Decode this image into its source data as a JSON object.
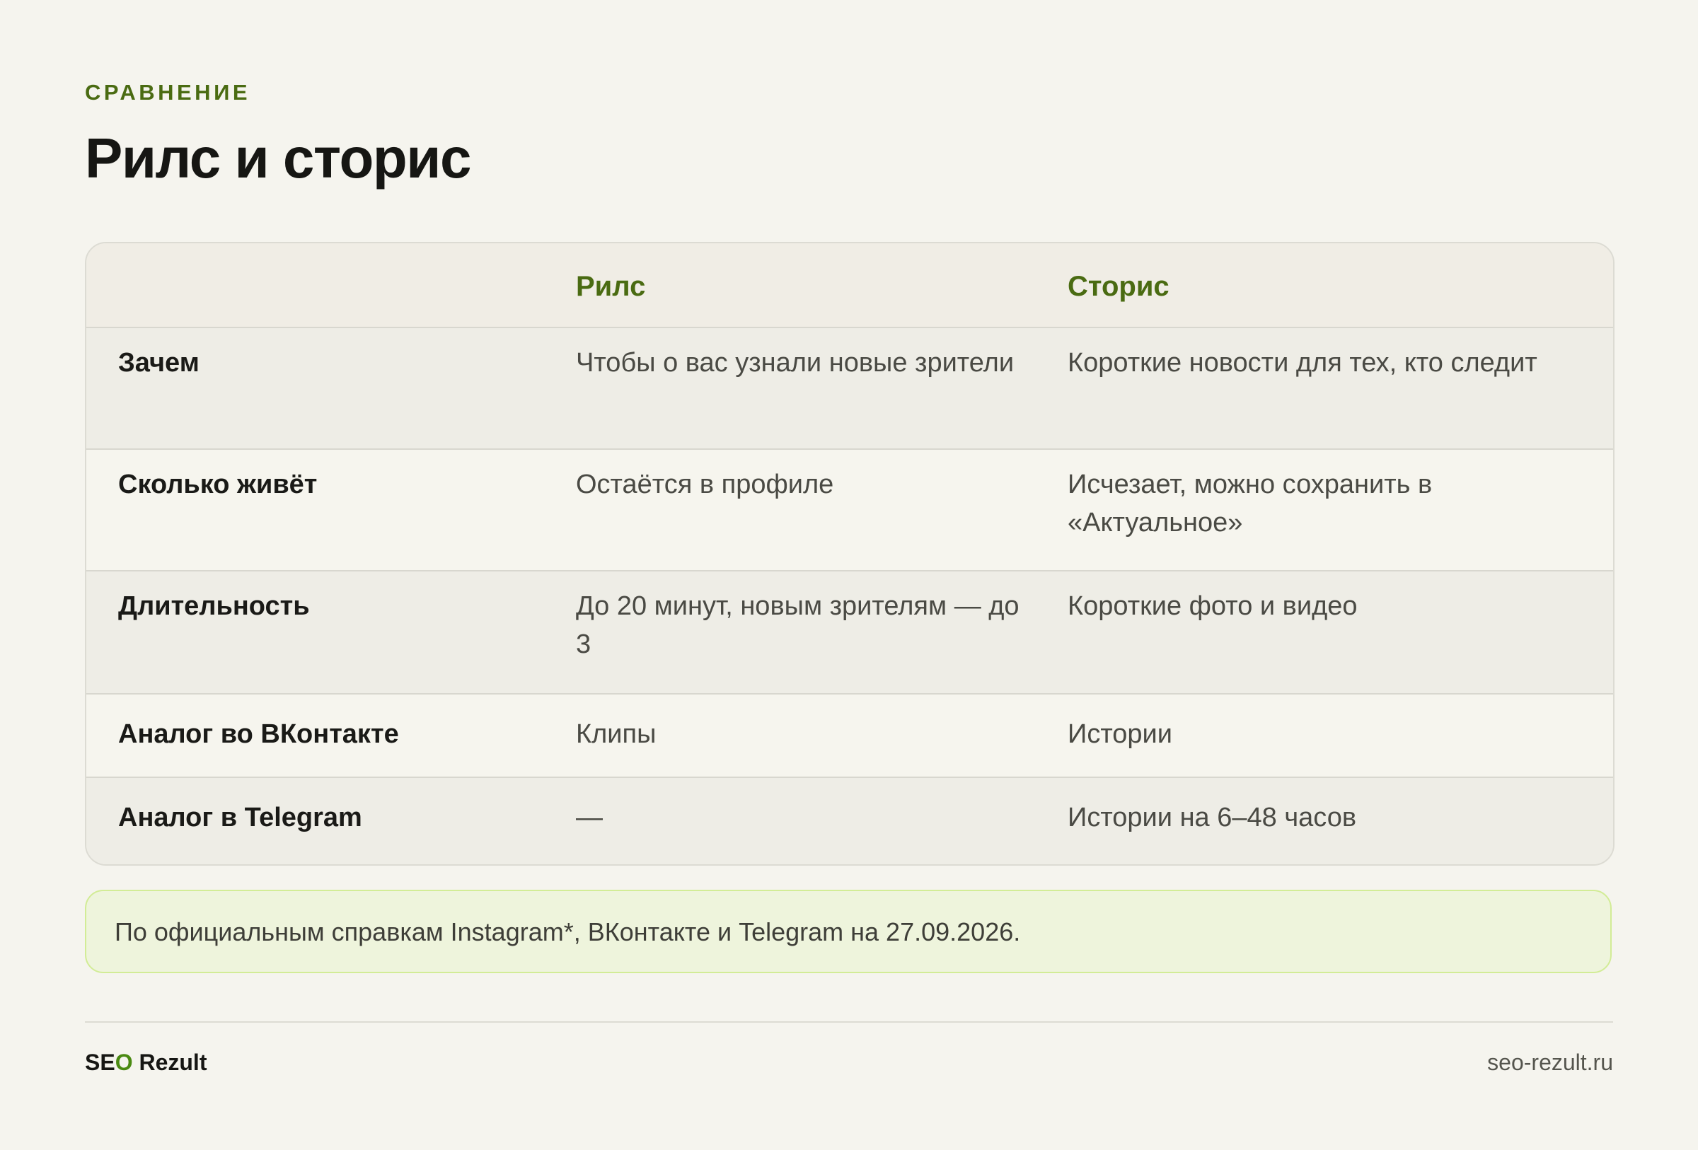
{
  "header": {
    "eyebrow": "СРАВНЕНИЕ",
    "title": "Рилс и сторис"
  },
  "table": {
    "columns": [
      "",
      "Рилс",
      "Сторис"
    ],
    "rows": [
      {
        "label": "Зачем",
        "reels": "Чтобы о вас узнали новые зрители",
        "stories": "Короткие новости для тех, кто следит"
      },
      {
        "label": "Сколько живёт",
        "reels": "Остаётся в профиле",
        "stories": "Исчезает, можно сохранить в «Актуальное»"
      },
      {
        "label": "Длительность",
        "reels": "До 20 минут, новым зрителям — до 3",
        "stories": "Короткие фото и видео"
      },
      {
        "label": "Аналог во ВКонтакте",
        "reels": "Клипы",
        "stories": "Истории"
      },
      {
        "label": "Аналог в Telegram",
        "reels": "—",
        "stories": "Истории на 6–48 часов"
      }
    ]
  },
  "note": {
    "text": "По официальным справкам Instagram*, ВКонтакте и Telegram на 27.09.2026."
  },
  "footer": {
    "brand_part1": "SE",
    "brand_accent": "O",
    "brand_part2": " Rezult",
    "site": "seo-rezult.ru"
  },
  "colors": {
    "background": "#f5f4ee",
    "accent_green": "#4a6b12",
    "note_bg": "#eef4dc",
    "note_border": "#d2ec96"
  }
}
